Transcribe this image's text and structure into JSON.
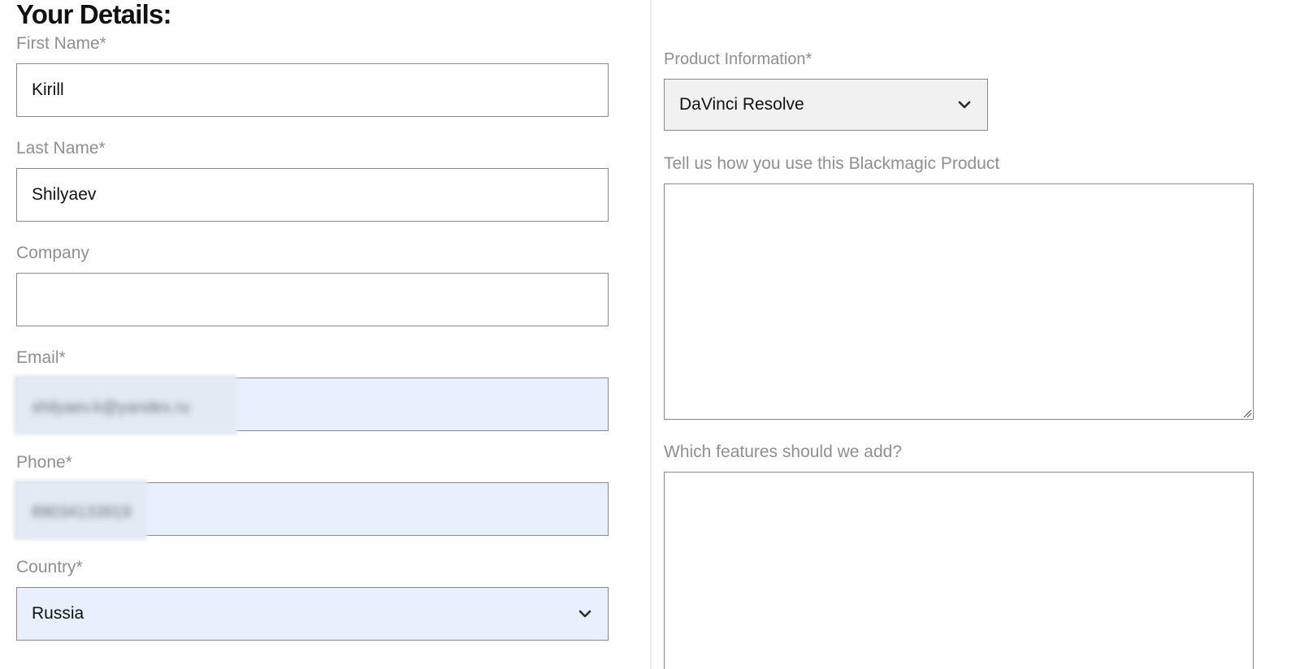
{
  "form": {
    "heading": "Your Details:",
    "first_name": {
      "label": "First Name*",
      "value": "Kirill"
    },
    "last_name": {
      "label": "Last Name*",
      "value": "Shilyaev"
    },
    "company": {
      "label": "Company",
      "value": ""
    },
    "email": {
      "label": "Email*",
      "value": "shilyaev.k@yandex.ru"
    },
    "phone": {
      "label": "Phone*",
      "value": "89034133919"
    },
    "country": {
      "label": "Country*",
      "value": "Russia"
    },
    "product": {
      "label": "Product Information*",
      "value": "DaVinci Resolve"
    },
    "usage": {
      "label": "Tell us how you use this Blackmagic Product",
      "value": ""
    },
    "features": {
      "label": "Which features should we add?",
      "value": ""
    }
  },
  "icons": {
    "country_chevron": "chevron-down-icon",
    "product_chevron": "chevron-down-icon",
    "resize_grip": "resize-grip-icon"
  },
  "colors": {
    "autofill_background": "#e8f0fe",
    "label_text": "#8f8f8f",
    "select_background": "#f1f1f1",
    "border": "#8a8a8a"
  }
}
